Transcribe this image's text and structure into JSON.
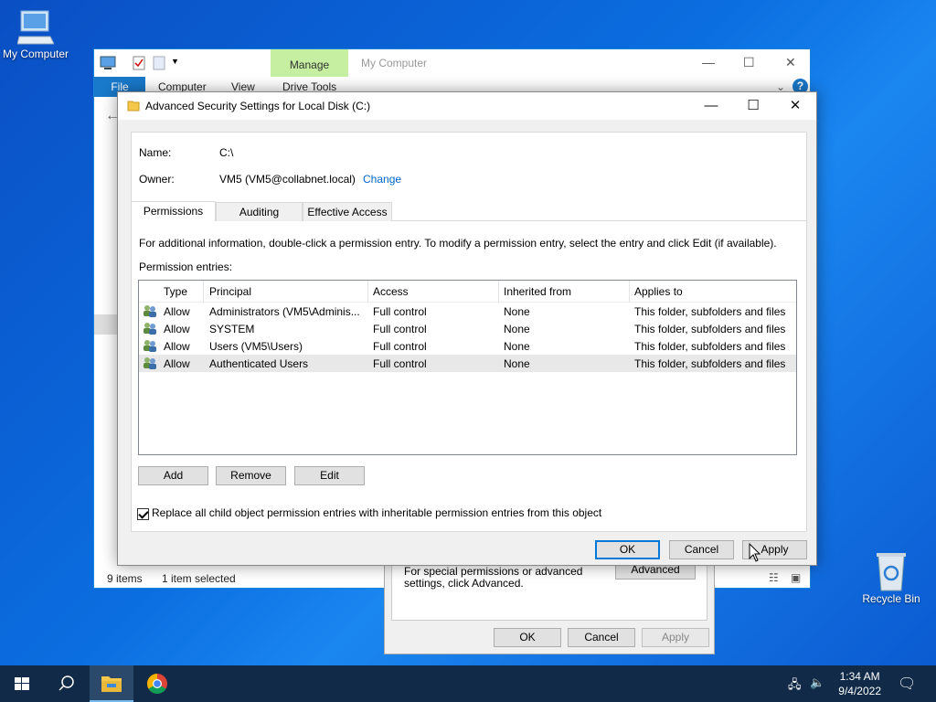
{
  "desktop": {
    "my_computer_label": "My Computer",
    "recycle_bin_label": "Recycle Bin"
  },
  "explorer": {
    "title": "My Computer",
    "manage_tab": "Manage",
    "file_tab": "File",
    "tabs": [
      "Computer",
      "View",
      "Drive Tools"
    ],
    "status_items": "9 items",
    "status_selected": "1 item selected"
  },
  "props": {
    "hint": "For special permissions or advanced settings, click Advanced.",
    "advanced_button": "Advanced",
    "ok": "OK",
    "cancel": "Cancel",
    "apply": "Apply"
  },
  "dialog": {
    "title": "Advanced Security Settings for Local Disk (C:)",
    "name_label": "Name:",
    "name_value": "C:\\",
    "owner_label": "Owner:",
    "owner_value": "VM5 (VM5@collabnet.local)",
    "change_link": "Change",
    "tabs": [
      "Permissions",
      "Auditing",
      "Effective Access"
    ],
    "info_text": "For additional information, double-click a permission entry. To modify a permission entry, select the entry and click Edit (if available).",
    "entries_label": "Permission entries:",
    "columns": [
      "Type",
      "Principal",
      "Access",
      "Inherited from",
      "Applies to"
    ],
    "rows": [
      {
        "type": "Allow",
        "principal": "Administrators (VM5\\Adminis...",
        "access": "Full control",
        "inherited": "None",
        "applies": "This folder, subfolders and files"
      },
      {
        "type": "Allow",
        "principal": "SYSTEM",
        "access": "Full control",
        "inherited": "None",
        "applies": "This folder, subfolders and files"
      },
      {
        "type": "Allow",
        "principal": "Users (VM5\\Users)",
        "access": "Full control",
        "inherited": "None",
        "applies": "This folder, subfolders and files"
      },
      {
        "type": "Allow",
        "principal": "Authenticated Users",
        "access": "Full control",
        "inherited": "None",
        "applies": "This folder, subfolders and files"
      }
    ],
    "add_button": "Add",
    "remove_button": "Remove",
    "edit_button": "Edit",
    "replace_checkbox_label": "Replace all child object permission entries with inheritable permission entries from this object",
    "replace_checked": true,
    "ok_button": "OK",
    "cancel_button": "Cancel",
    "apply_button": "Apply"
  },
  "taskbar": {
    "time": "1:34 AM",
    "date": "9/4/2022"
  },
  "colors": {
    "accent": "#0078d7",
    "manage_tab": "#c6efa1",
    "link": "#0066cc",
    "taskbar": "#102a47"
  }
}
